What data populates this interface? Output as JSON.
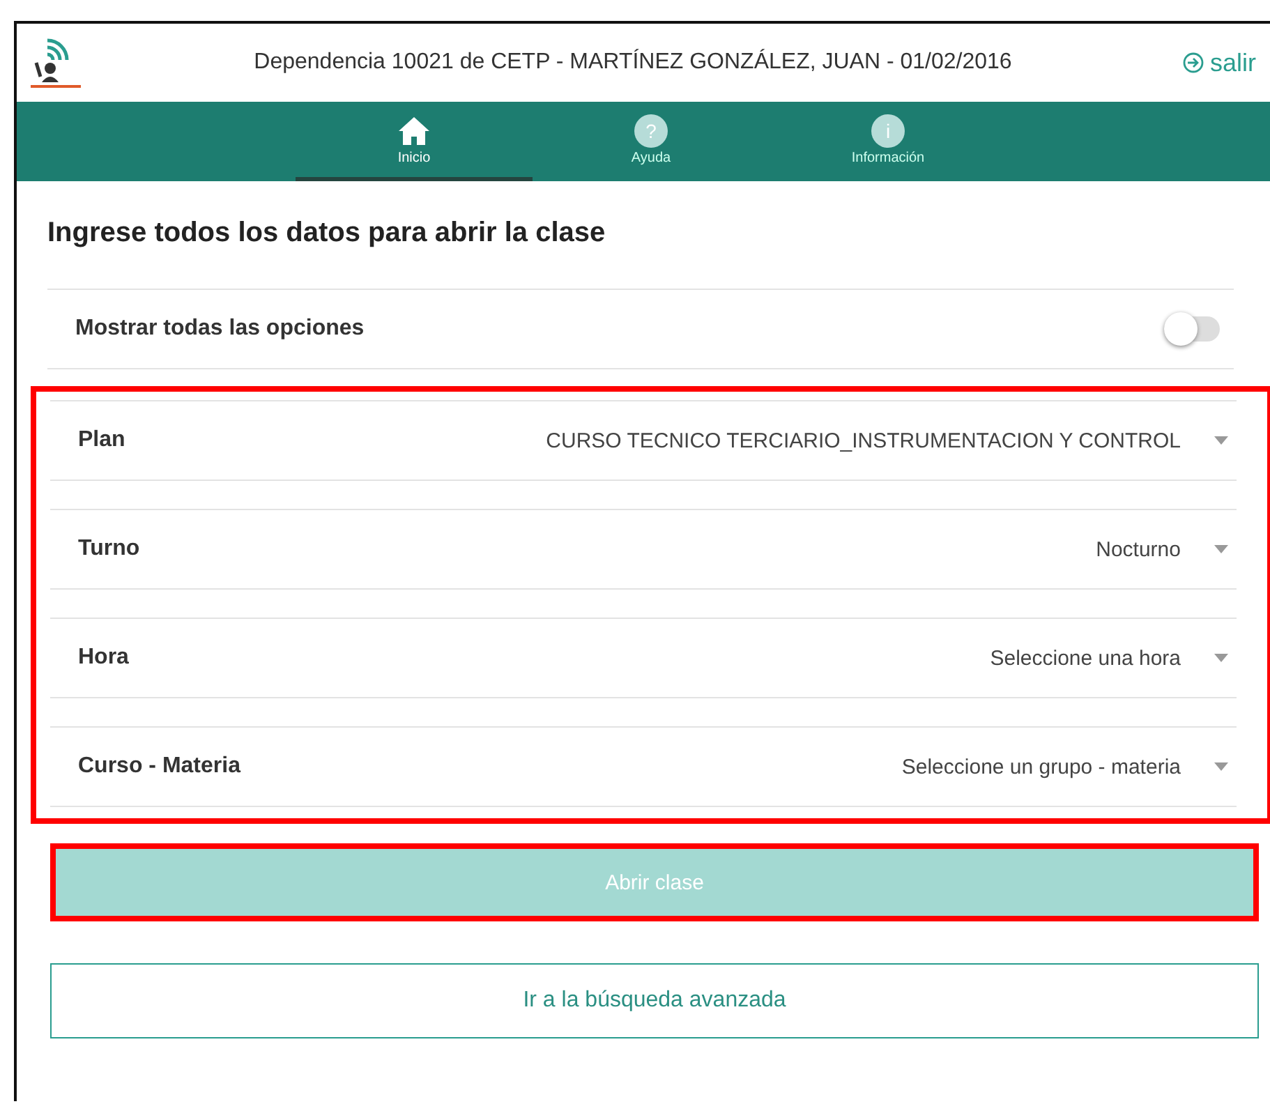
{
  "header": {
    "title": "Dependencia 10021 de CETP -  MARTÍNEZ GONZÁLEZ, JUAN   - 01/02/2016",
    "logout": "salir"
  },
  "tabs": [
    {
      "kind": "home",
      "label": "Inicio",
      "selected": true
    },
    {
      "kind": "glyph",
      "glyph": "?",
      "label": "Ayuda",
      "selected": false
    },
    {
      "kind": "glyph",
      "glyph": "i",
      "label": "Información",
      "selected": false
    }
  ],
  "heading": "Ingrese todos los datos para abrir la clase",
  "toggle": {
    "label": "Mostrar todas las opciones",
    "on": false
  },
  "fields": [
    {
      "label": "Plan",
      "value": "CURSO TECNICO TERCIARIO_INSTRUMENTACION Y CONTROL"
    },
    {
      "label": "Turno",
      "value": "Nocturno"
    },
    {
      "label": "Hora",
      "value": "Seleccione una hora"
    },
    {
      "label": "Curso - Materia",
      "value": "Seleccione un grupo - materia"
    }
  ],
  "primary_button": {
    "label": "Abrir clase",
    "disabled": true
  },
  "secondary_button": {
    "label": "Ir a la búsqueda avanzada"
  }
}
